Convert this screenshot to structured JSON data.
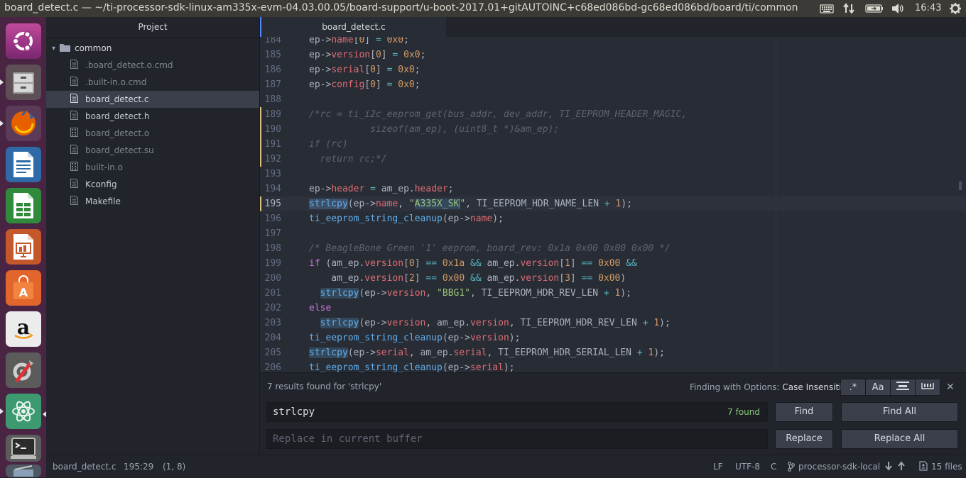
{
  "window": {
    "title": "board_detect.c — ~/ti-processor-sdk-linux-am335x-evm-04.03.00.05/board-support/u-boot-2017.01+gitAUTOINC+c68ed086bd-gc68ed086bd/board/ti/common",
    "clock": "16:43"
  },
  "launcher": {
    "apps": [
      "ubuntu-dash",
      "files",
      "firefox",
      "libreoffice-writer",
      "libreoffice-calc",
      "libreoffice-impress",
      "ubuntu-software",
      "amazon",
      "system-settings",
      "atom",
      "terminal",
      "scanner"
    ]
  },
  "tree": {
    "header": "Project",
    "folder": "common",
    "files": [
      {
        "name": ".board_detect.o.cmd",
        "icon": "file-text-icon",
        "dim": true,
        "selected": false
      },
      {
        "name": ".built-in.o.cmd",
        "icon": "file-text-icon",
        "dim": true,
        "selected": false
      },
      {
        "name": "board_detect.c",
        "icon": "file-text-icon",
        "dim": false,
        "selected": true
      },
      {
        "name": "board_detect.h",
        "icon": "file-text-icon",
        "dim": false,
        "selected": false
      },
      {
        "name": "board_detect.o",
        "icon": "file-binary-icon",
        "dim": true,
        "selected": false
      },
      {
        "name": "board_detect.su",
        "icon": "file-text-icon",
        "dim": true,
        "selected": false
      },
      {
        "name": "built-in.o",
        "icon": "file-binary-icon",
        "dim": true,
        "selected": false
      },
      {
        "name": "Kconfig",
        "icon": "file-text-icon",
        "dim": false,
        "selected": false
      },
      {
        "name": "Makefile",
        "icon": "file-text-icon",
        "dim": false,
        "selected": false
      }
    ]
  },
  "editor": {
    "tab": "board_detect.c",
    "current_line": "195",
    "lines": [
      {
        "n": "184",
        "c": "ep->name[0] = 0x0;"
      },
      {
        "n": "185",
        "c": "ep->version[0] = 0x0;"
      },
      {
        "n": "186",
        "c": "ep->serial[0] = 0x0;"
      },
      {
        "n": "187",
        "c": "ep->config[0] = 0x0;"
      },
      {
        "n": "188",
        "c": ""
      },
      {
        "n": "189",
        "c": "/*rc = ti_i2c_eeprom_get(bus_addr, dev_addr, TI_EEPROM_HEADER_MAGIC,"
      },
      {
        "n": "190",
        "c": "           sizeof(am_ep), (uint8_t *)&am_ep);"
      },
      {
        "n": "191",
        "c": "if (rc)"
      },
      {
        "n": "192",
        "c": "  return rc;*/"
      },
      {
        "n": "193",
        "c": ""
      },
      {
        "n": "194",
        "c": "ep->header = am_ep.header;"
      },
      {
        "n": "195",
        "c": "strlcpy(ep->name, \"A335X_SK\", TI_EEPROM_HDR_NAME_LEN + 1);"
      },
      {
        "n": "196",
        "c": "ti_eeprom_string_cleanup(ep->name);"
      },
      {
        "n": "197",
        "c": ""
      },
      {
        "n": "198",
        "c": "/* BeagleBone Green '1' eeprom, board_rev: 0x1a 0x00 0x00 0x00 */"
      },
      {
        "n": "199",
        "c": "if (am_ep.version[0] == 0x1a && am_ep.version[1] == 0x00 &&"
      },
      {
        "n": "200",
        "c": "    am_ep.version[2] == 0x00 && am_ep.version[3] == 0x00)"
      },
      {
        "n": "201",
        "c": "  strlcpy(ep->version, \"BBG1\", TI_EEPROM_HDR_REV_LEN + 1);"
      },
      {
        "n": "202",
        "c": "else"
      },
      {
        "n": "203",
        "c": "  strlcpy(ep->version, am_ep.version, TI_EEPROM_HDR_REV_LEN + 1);"
      },
      {
        "n": "204",
        "c": "ti_eeprom_string_cleanup(ep->version);"
      },
      {
        "n": "205",
        "c": "strlcpy(ep->serial, am_ep.serial, TI_EEPROM_HDR_SERIAL_LEN + 1);"
      },
      {
        "n": "206",
        "c": "ti_eeprom_string_cleanup(ep->serial);"
      }
    ]
  },
  "find": {
    "status": "7 results found for 'strlcpy'",
    "options_prefix": "Finding with Options:",
    "options_value": "Case Insensitive",
    "option_buttons": [
      ".*",
      "Aa",
      "",
      ""
    ],
    "query": "strlcpy",
    "count": "7 found",
    "replace_placeholder": "Replace in current buffer",
    "find_label": "Find",
    "find_all_label": "Find All",
    "replace_label": "Replace",
    "replace_all_label": "Replace All"
  },
  "status": {
    "file": "board_detect.c",
    "cursor": "195:29",
    "selection": "(1, 8)",
    "line_ending": "LF",
    "encoding": "UTF-8",
    "grammar": "C",
    "branch": "processor-sdk-local",
    "files": "15 files"
  }
}
